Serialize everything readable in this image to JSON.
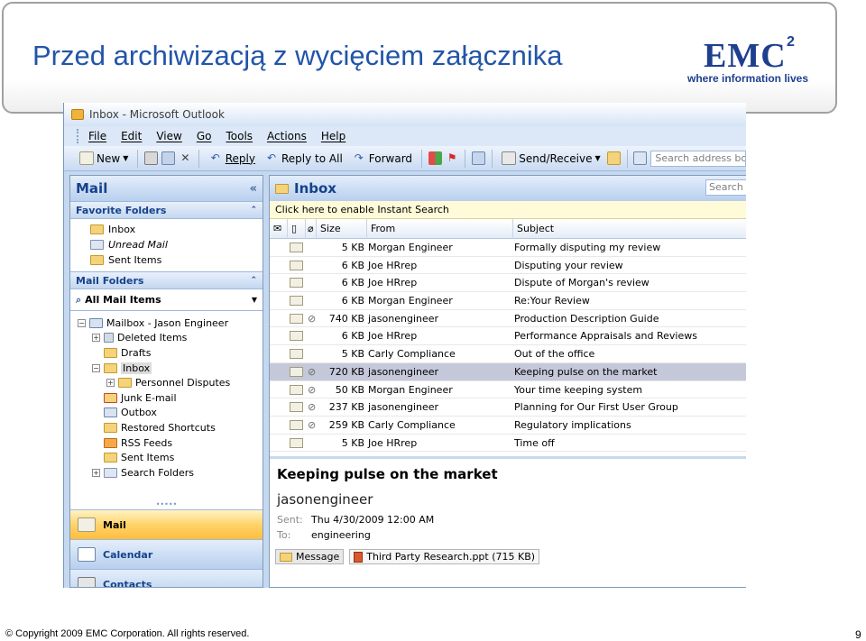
{
  "slide": {
    "title": "Przed archiwizacją z wycięciem załącznika",
    "logo_text": "EMC",
    "logo_superscript": "2",
    "logo_tagline": "where information lives",
    "footer": "© Copyright 2009 EMC Corporation. All rights reserved.",
    "page_number": "9"
  },
  "window": {
    "title": "Inbox - Microsoft Outlook"
  },
  "menu": [
    "File",
    "Edit",
    "View",
    "Go",
    "Tools",
    "Actions",
    "Help"
  ],
  "toolbar": {
    "new": "New",
    "reply": "Reply",
    "reply_all": "Reply to All",
    "forward": "Forward",
    "send_receive": "Send/Receive",
    "search_placeholder": "Search address books"
  },
  "nav": {
    "title": "Mail",
    "favorite_header": "Favorite Folders",
    "favorites": [
      "Inbox",
      "Unread Mail",
      "Sent Items"
    ],
    "mail_folders_header": "Mail Folders",
    "all_mail_items": "All Mail Items",
    "tree": [
      {
        "label": "Mailbox - Jason Engineer",
        "expander": "−"
      },
      {
        "label": "Deleted Items",
        "expander": "+"
      },
      {
        "label": "Drafts",
        "expander": ""
      },
      {
        "label": "Inbox",
        "expander": "−"
      },
      {
        "label": "Personnel Disputes",
        "expander": "+"
      },
      {
        "label": "Junk E-mail",
        "expander": ""
      },
      {
        "label": "Outbox",
        "expander": ""
      },
      {
        "label": "Restored Shortcuts",
        "expander": ""
      },
      {
        "label": "RSS Feeds",
        "expander": ""
      },
      {
        "label": "Sent Items",
        "expander": ""
      },
      {
        "label": "Search Folders",
        "expander": "+"
      }
    ],
    "buttons": [
      "Mail",
      "Calendar",
      "Contacts"
    ]
  },
  "inbox": {
    "title": "Inbox",
    "search_placeholder": "Search In",
    "instant_search": "Click here to enable Instant Search",
    "columns": {
      "size": "Size",
      "from": "From",
      "subject": "Subject"
    },
    "messages": [
      {
        "attach": "",
        "size": "5 KB",
        "from": "Morgan Engineer",
        "subject": "Formally disputing my review"
      },
      {
        "attach": "",
        "size": "6 KB",
        "from": "Joe HRrep",
        "subject": "Disputing your review"
      },
      {
        "attach": "",
        "size": "6 KB",
        "from": "Joe HRrep",
        "subject": "Dispute of Morgan's review"
      },
      {
        "attach": "",
        "size": "6 KB",
        "from": "Morgan Engineer",
        "subject": "Re:Your Review"
      },
      {
        "attach": "⊘",
        "size": "740 KB",
        "from": "jasonengineer",
        "subject": "Production Description Guide"
      },
      {
        "attach": "",
        "size": "6 KB",
        "from": "Joe HRrep",
        "subject": "Performance Appraisals and Reviews"
      },
      {
        "attach": "",
        "size": "5 KB",
        "from": "Carly Compliance",
        "subject": "Out of the office"
      },
      {
        "attach": "⊘",
        "size": "720 KB",
        "from": "jasonengineer",
        "subject": "Keeping pulse on the market"
      },
      {
        "attach": "⊘",
        "size": "50 KB",
        "from": "Morgan Engineer",
        "subject": "Your time keeping system"
      },
      {
        "attach": "⊘",
        "size": "237 KB",
        "from": "jasonengineer",
        "subject": "Planning for Our First User Group"
      },
      {
        "attach": "⊘",
        "size": "259 KB",
        "from": "Carly Compliance",
        "subject": "Regulatory implications"
      },
      {
        "attach": "",
        "size": "5 KB",
        "from": "Joe HRrep",
        "subject": "Time off"
      }
    ]
  },
  "reading": {
    "subject": "Keeping pulse on the market",
    "from": "jasonengineer",
    "sent_label": "Sent:",
    "sent_value": "Thu 4/30/2009 12:00 AM",
    "to_label": "To:",
    "to_value": "engineering",
    "message_tab": "Message",
    "attachment": "Third Party Research.ppt (715 KB)"
  }
}
